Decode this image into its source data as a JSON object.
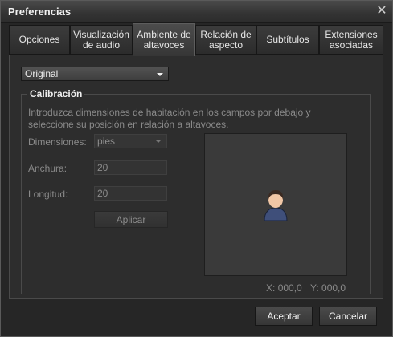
{
  "window": {
    "title": "Preferencias"
  },
  "tabs": [
    {
      "label": "Opciones"
    },
    {
      "label": "Visualización de audio"
    },
    {
      "label": "Ambiente de altavoces"
    },
    {
      "label": "Relación de aspecto"
    },
    {
      "label": "Subtítulos"
    },
    {
      "label": "Extensiones asociadas"
    }
  ],
  "mode_select": {
    "value": "Original"
  },
  "calibration": {
    "title": "Calibración",
    "description": "Introduzca dimensiones de habitación en los campos por debajo y seleccione su posición en relación a altavoces.",
    "dimensions_label": "Dimensiones:",
    "dimensions_value": "pies",
    "width_label": "Anchura:",
    "width_value": "20",
    "length_label": "Longitud:",
    "length_value": "20",
    "apply_label": "Aplicar",
    "x_label": "X:",
    "x_value": "000,0",
    "y_label": "Y:",
    "y_value": "000,0"
  },
  "footer": {
    "accept_label": "Aceptar",
    "cancel_label": "Cancelar"
  },
  "colors": {
    "background": "#262626",
    "panel": "#2d2d2d",
    "text": "#e8e8e8",
    "disabled_text": "#8a8a8a"
  },
  "icons": [
    "close-icon",
    "dropdown-arrow-icon",
    "user-avatar-icon"
  ]
}
